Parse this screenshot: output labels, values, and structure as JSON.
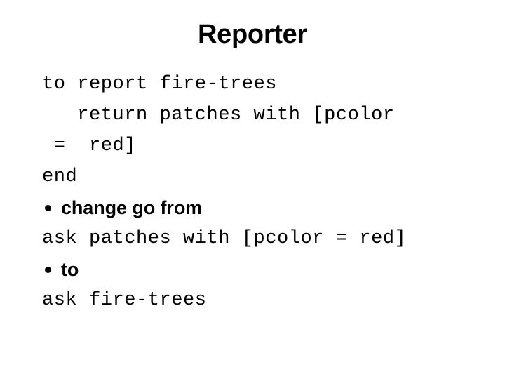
{
  "slide": {
    "title": "Reporter",
    "background_color": "#ffffff",
    "text_color": "#000000",
    "lines": [
      {
        "id": "line-1",
        "kind": "code",
        "text": "to report fire-trees"
      },
      {
        "id": "line-2",
        "kind": "code",
        "text": "   return patches with [pcolor"
      },
      {
        "id": "line-3",
        "kind": "code",
        "text": " =  red]"
      },
      {
        "id": "line-4",
        "kind": "code",
        "text": "end"
      },
      {
        "id": "line-5",
        "kind": "bullet",
        "text": "change go from",
        "bullet": "•"
      },
      {
        "id": "line-6",
        "kind": "code",
        "text": "ask patches with [pcolor = red]"
      },
      {
        "id": "line-7",
        "kind": "bullet",
        "text": "to",
        "bullet": "•"
      },
      {
        "id": "line-8",
        "kind": "code",
        "text": "ask fire-trees"
      }
    ]
  }
}
